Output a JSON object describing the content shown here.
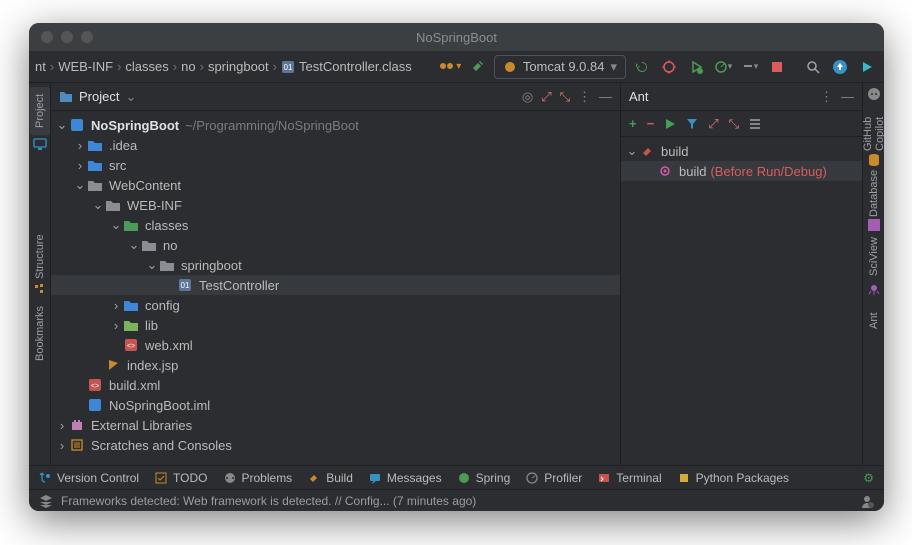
{
  "title": "NoSpringBoot",
  "breadcrumb": [
    "nt",
    "WEB-INF",
    "classes",
    "no",
    "springboot",
    "TestController.class"
  ],
  "runconfig": "Tomcat 9.0.84",
  "project": {
    "panel_title": "Project",
    "root": "NoSpringBoot",
    "root_path": "~/Programming/NoSpringBoot",
    "tree": {
      "idea": ".idea",
      "src": "src",
      "webcontent": "WebContent",
      "webinf": "WEB-INF",
      "classes": "classes",
      "no": "no",
      "springboot": "springboot",
      "testcontroller": "TestController",
      "config": "config",
      "lib": "lib",
      "webxml": "web.xml",
      "indexjsp": "index.jsp",
      "buildxml": "build.xml",
      "iml": "NoSpringBoot.iml",
      "extlib": "External Libraries",
      "scratch": "Scratches and Consoles"
    }
  },
  "ant": {
    "title": "Ant",
    "root": "build",
    "target": "build",
    "annotation": "(Before Run/Debug)"
  },
  "rightstrip": [
    "GitHub Copilot",
    "Database",
    "SciView",
    "Ant"
  ],
  "bottom": {
    "vc": "Version Control",
    "todo": "TODO",
    "problems": "Problems",
    "build": "Build",
    "messages": "Messages",
    "spring": "Spring",
    "profiler": "Profiler",
    "terminal": "Terminal",
    "python": "Python Packages"
  },
  "status": "Frameworks detected: Web framework is detected. // Config... (7 minutes ago)"
}
